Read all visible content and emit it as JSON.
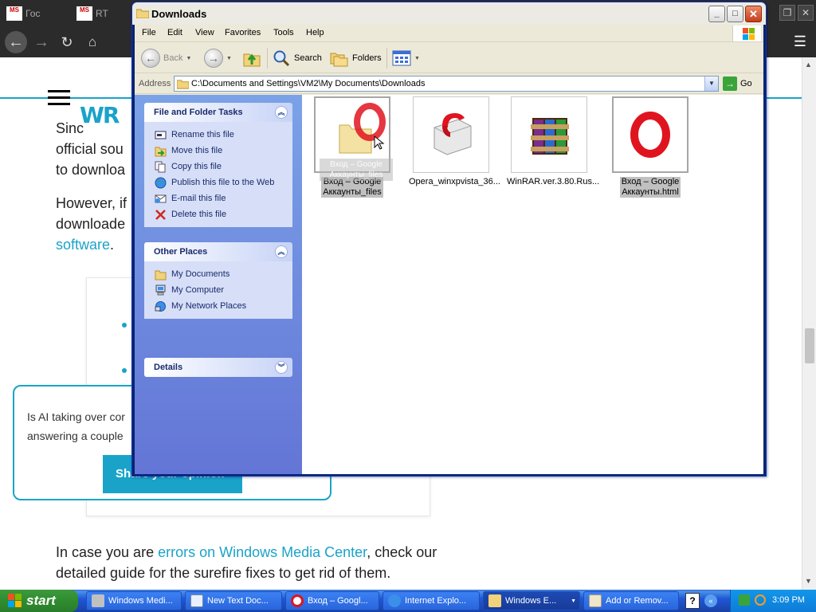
{
  "browser": {
    "tabs": [
      {
        "icon_text": "MS",
        "label": "Гос"
      },
      {
        "icon_text": "MS",
        "label": "RT"
      }
    ],
    "logo": "WR",
    "paragraphs": [
      {
        "lines": [
          "Sinc",
          "official sou",
          "to downloa"
        ]
      },
      {
        "lines": [
          "However, if",
          "downloade"
        ],
        "link": "software",
        "tail": "."
      }
    ],
    "survey": {
      "line1": "Is AI taking over cor",
      "line2": "answering a couple",
      "button": "Share your opinion"
    },
    "bottom_para": {
      "prefix": "In case you are ",
      "link": "errors on Windows Media Center",
      "suffix": ", check our",
      "line2": "detailed guide for the surefire fixes to get rid of them."
    }
  },
  "window": {
    "title": "Downloads",
    "menu": [
      "File",
      "Edit",
      "View",
      "Favorites",
      "Tools",
      "Help"
    ],
    "toolbar": {
      "back": "Back",
      "search": "Search",
      "folders": "Folders"
    },
    "address": {
      "label": "Address",
      "path": "C:\\Documents and Settings\\VM2\\My Documents\\Downloads",
      "go": "Go"
    },
    "tasks": {
      "title": "File and Folder Tasks",
      "items": [
        {
          "label": "Rename this file",
          "icon": "rename-icon"
        },
        {
          "label": "Move this file",
          "icon": "move-icon"
        },
        {
          "label": "Copy this file",
          "icon": "copy-icon"
        },
        {
          "label": "Publish this file to the Web",
          "icon": "globe-icon"
        },
        {
          "label": "E-mail this file",
          "icon": "email-icon"
        },
        {
          "label": "Delete this file",
          "icon": "delete-icon"
        }
      ]
    },
    "other_places": {
      "title": "Other Places",
      "items": [
        {
          "label": "My Documents",
          "icon": "folder-icon"
        },
        {
          "label": "My Computer",
          "icon": "computer-icon"
        },
        {
          "label": "My Network Places",
          "icon": "network-icon"
        }
      ]
    },
    "details": {
      "title": "Details"
    },
    "files": [
      {
        "name1": "Вход – Google",
        "name2": "Аккаунты_files",
        "kind": "folder",
        "selected": true
      },
      {
        "name1": "Opera_winxpvista_36...",
        "name2": "",
        "kind": "installer",
        "selected": false
      },
      {
        "name1": "WinRAR.ver.3.80.Rus...",
        "name2": "",
        "kind": "archive",
        "selected": false
      },
      {
        "name1": "Вход – Google",
        "name2": "Аккаунты.html",
        "kind": "opera-html",
        "selected": true
      }
    ],
    "drag_ghost": {
      "line1": "Вход – Google",
      "line2": "Аккаунты_files"
    }
  },
  "taskbar": {
    "start": "start",
    "tasks": [
      {
        "label": "Windows Medi...",
        "color": "#c0c0c0"
      },
      {
        "label": "New Text Doc...",
        "color": "#e8f0ff"
      },
      {
        "label": "Вход – Googl...",
        "color": "#e0141e"
      },
      {
        "label": "Internet Explo...",
        "color": "#3b8fe8"
      },
      {
        "label": "Windows E...",
        "color": "#f2d27a"
      },
      {
        "label": "Add or Remov...",
        "color": "#f0e6c8"
      }
    ],
    "help": "?",
    "clock": "3:09 PM"
  },
  "colors": {
    "xp_blue": "#0a246a",
    "accent_teal": "#1aa3c9",
    "opera_red": "#e0141e"
  }
}
